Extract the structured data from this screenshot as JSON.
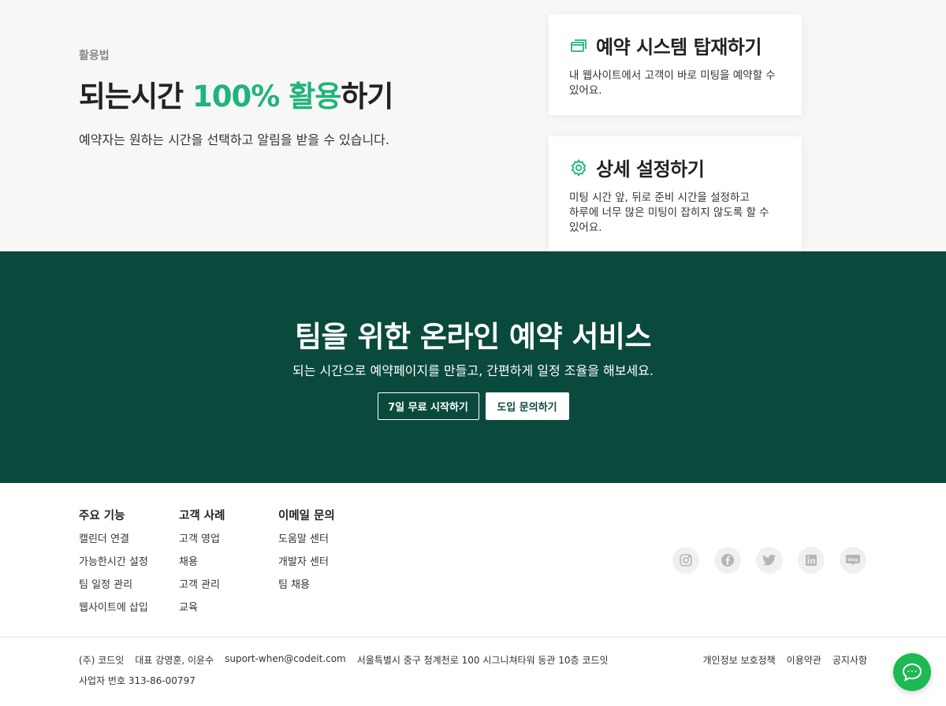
{
  "hero": {
    "eyebrow": "활용법",
    "headline_pre": "되는시간 ",
    "headline_accent": "100% 활용",
    "headline_post": "하기",
    "subline": "예약자는 원하는 시간을 선택하고 알림을 받을 수 있습니다."
  },
  "cards": [
    {
      "icon": "windows-icon",
      "title": "예약 시스템 탑재하기",
      "desc": "내 웹사이트에서 고객이 바로 미팅을 예약할 수 있어요."
    },
    {
      "icon": "gear-icon",
      "title": "상세 설정하기",
      "desc_line1": "미팅 시간 앞, 뒤로 준비 시간을 설정하고",
      "desc_line2": "하루에 너무 많은 미팅이 잡히지 않도록 할 수 있어요."
    }
  ],
  "banner": {
    "title": "팀을 위한 온라인 예약 서비스",
    "subtitle": "되는 시간으로 예약페이지를 만들고, 간편하게 일정 조율을 해보세요.",
    "btn_trial": "7일 무료 시작하기",
    "btn_inquiry": "도입 문의하기"
  },
  "footer": {
    "col1": {
      "title": "주요 기능",
      "items": [
        "캘린더 연결",
        "가능한시간 설정",
        "팀 일정 관리",
        "웹사이트에 삽입"
      ]
    },
    "col2": {
      "title": "고객 사례",
      "items": [
        "고객 영업",
        "채용",
        "고객 관리",
        "교육"
      ]
    },
    "col3": {
      "title": "이메일 문의",
      "items": [
        "도움말 센터",
        "개발자 센터",
        "팀 채용"
      ]
    },
    "socials": [
      "instagram-icon",
      "facebook-icon",
      "twitter-icon",
      "linkedin-icon",
      "blog-icon"
    ],
    "blog_label": "blog",
    "company": "(주) 코드잇",
    "ceo": "대표 강영훈, 이윤수",
    "email": "suport-when@codeit.com",
    "address": "서울특별시 중구 청계천로 100 시그니쳐타워 동관 10층 코드잇",
    "biz_no": "사업자 번호 313-86-00797",
    "links": [
      "개인정보 보호정책",
      "이용약관",
      "공지사항"
    ]
  },
  "colors": {
    "accent": "#1fb47a",
    "banner_bg": "#094a3d",
    "chat_fab": "#1db954"
  }
}
